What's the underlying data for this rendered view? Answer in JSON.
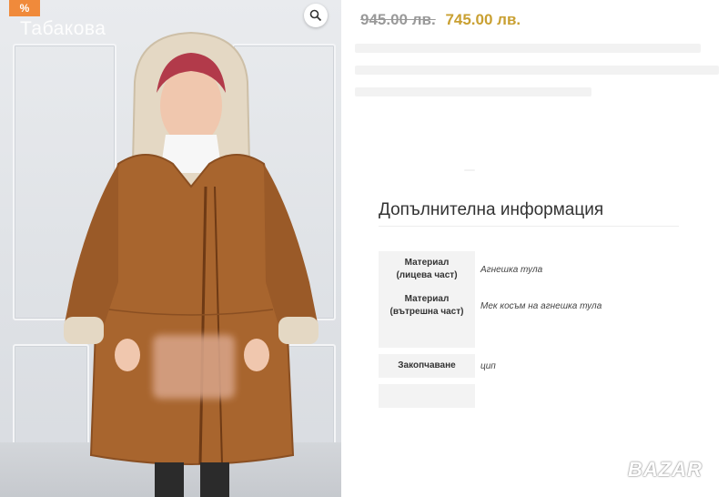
{
  "badge": {
    "label": "%"
  },
  "photo": {
    "watermark": "Табакова"
  },
  "price": {
    "old": "945.00 лв.",
    "new": "745.00 лв."
  },
  "info": {
    "title": "Допълнителна информация",
    "rows": [
      {
        "label_line1": "Материал",
        "label_line2": "(лицева част)",
        "value": "Агнешка тула"
      },
      {
        "label_line1": "Материал",
        "label_line2": "(вътрешна част)",
        "value": "Мек косъм на агнешка тула"
      },
      {
        "label_line1": "Закопчаване",
        "label_line2": "",
        "value": "цип"
      }
    ]
  },
  "logo": {
    "text": "BAZAR"
  },
  "colors": {
    "accent_price": "#c9a032",
    "badge": "#f08a3b",
    "coat": "#a8652e",
    "fur": "#e7dccb"
  },
  "icons": {
    "zoom": "magnifier-icon"
  }
}
